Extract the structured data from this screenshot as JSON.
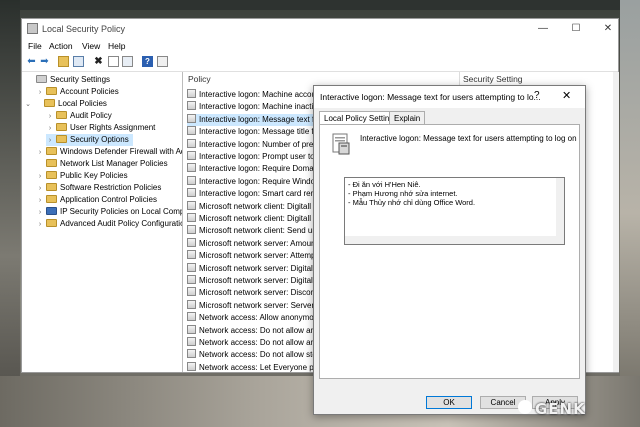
{
  "main_window": {
    "title": "Local Security Policy",
    "buttons": {
      "minimize": "—",
      "maximize": "☐",
      "close": "✕"
    },
    "menu": [
      "File",
      "Action",
      "View",
      "Help"
    ],
    "toolbar_icons": [
      "back-arrow-icon",
      "forward-arrow-icon",
      "folder-up-icon",
      "console-tree-icon",
      "delete-icon",
      "properties-icon",
      "export-icon",
      "help-icon",
      "snapin-icon"
    ]
  },
  "tree": {
    "items": [
      {
        "label": "Security Settings"
      },
      {
        "label": "Account Policies"
      },
      {
        "label": "Local Policies"
      },
      {
        "label": "Audit Policy"
      },
      {
        "label": "User Rights Assignment"
      },
      {
        "label": "Security Options"
      },
      {
        "label": "Windows Defender Firewall with Adva"
      },
      {
        "label": "Network List Manager Policies"
      },
      {
        "label": "Public Key Policies"
      },
      {
        "label": "Software Restriction Policies"
      },
      {
        "label": "Application Control Policies"
      },
      {
        "label": "IP Security Policies on Local Compute"
      },
      {
        "label": "Advanced Audit Policy Configuration"
      }
    ]
  },
  "list": {
    "columns": {
      "policy": "Policy",
      "security_setting": "Security Setting"
    },
    "rows": [
      "Interactive logon: Machine accou",
      "Interactive logon: Machine inacti",
      "Interactive logon: Message text fo",
      "Interactive logon: Message title fo",
      "Interactive logon: Number of prev",
      "Interactive logon: Prompt user to",
      "Interactive logon: Require Domai",
      "Interactive logon: Require Windo",
      "Interactive logon: Smart card rem",
      "Microsoft network client: Digitall",
      "Microsoft network client: Digitall",
      "Microsoft network client: Send ur",
      "Microsoft network server: Amoun",
      "Microsoft network server: Attemp",
      "Microsoft network server: Digitall",
      "Microsoft network server: Digitall",
      "Microsoft network server: Discon",
      "Microsoft network server: Server S",
      "Network access: Allow anonymou",
      "Network access: Do not allow an",
      "Network access: Do not allow an",
      "Network access: Do not allow sto",
      "Network access: Let Everyone per"
    ]
  },
  "dialog": {
    "title": "Interactive logon: Message text for users attempting to lo...",
    "help_glyph": "?",
    "close_glyph": "✕",
    "tabs": [
      "Local Policy Setting",
      "Explain"
    ],
    "policy_name": "Interactive logon: Message text for users attempting to log on",
    "text_lines": [
      "- Đi ăn với H'Hen Niê.",
      "- Phạm Hương nhớ sửa internet.",
      "- Mẫu Thủy nhớ chỉ dùng Office Word."
    ],
    "buttons": {
      "ok": "OK",
      "cancel": "Cancel",
      "apply": "Apply"
    }
  },
  "watermark": "GENK"
}
